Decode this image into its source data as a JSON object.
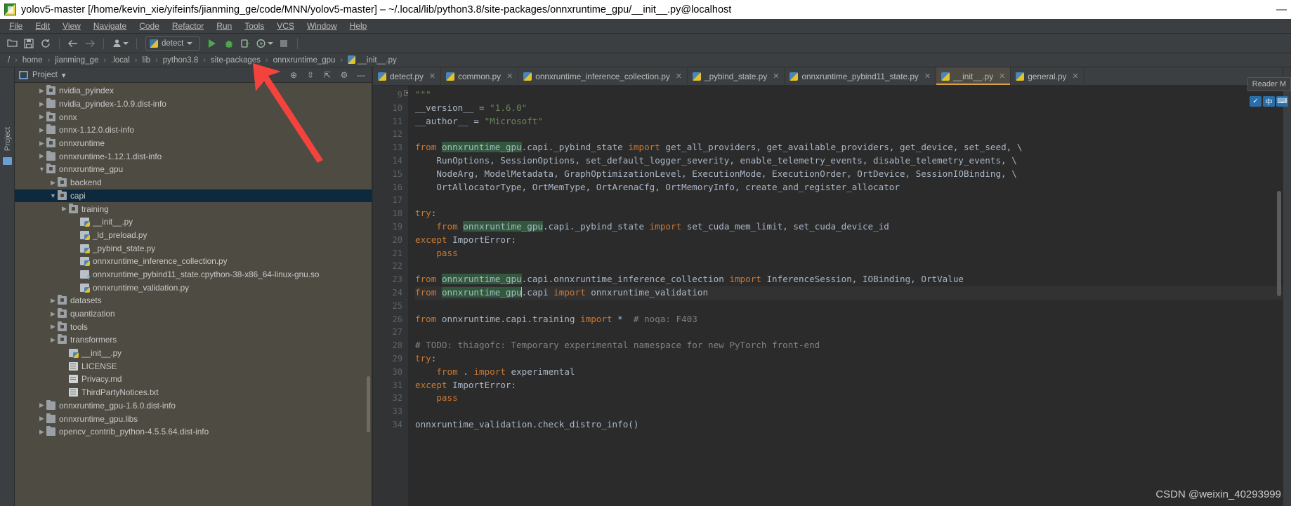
{
  "window": {
    "title": "yolov5-master [/home/kevin_xie/yifeinfs/jianming_ge/code/MNN/yolov5-master] – ~/.local/lib/python3.8/site-packages/onnxruntime_gpu/__init__.py@localhost",
    "icon": "pycharm-icon",
    "minimize": "—",
    "maximize": "▢",
    "close": "✕"
  },
  "menubar": {
    "items": [
      {
        "label": "File"
      },
      {
        "label": "Edit"
      },
      {
        "label": "View"
      },
      {
        "label": "Navigate"
      },
      {
        "label": "Code"
      },
      {
        "label": "Refactor"
      },
      {
        "label": "Run"
      },
      {
        "label": "Tools"
      },
      {
        "label": "VCS"
      },
      {
        "label": "Window"
      },
      {
        "label": "Help"
      }
    ]
  },
  "toolbar": {
    "open_label": "📂",
    "save_label": "🖫",
    "sync_label": "⟳",
    "back_label": "←",
    "forward_label": "→",
    "profile_label": "👤",
    "run_config": "detect",
    "run_label": "▶",
    "debug_label": "🐞",
    "coverage_label": "▣",
    "profile_run_label": "◷",
    "stop_label": "■"
  },
  "breadcrumb": {
    "separator": "›",
    "items": [
      {
        "label": "/"
      },
      {
        "label": "home"
      },
      {
        "label": "jianming_ge"
      },
      {
        "label": ".local"
      },
      {
        "label": "lib"
      },
      {
        "label": "python3.8"
      },
      {
        "label": "site-packages"
      },
      {
        "label": "onnxruntime_gpu"
      },
      {
        "label": "__init__.py",
        "icon": "python-file-icon"
      }
    ]
  },
  "left_rail": {
    "project_label": "Project",
    "structure_icon": "structure-icon"
  },
  "project_panel": {
    "title": "Project",
    "dropdown": "▾",
    "buttons": [
      {
        "name": "locate-button",
        "glyph": "⊕"
      },
      {
        "name": "expand-all-button",
        "glyph": "⇳"
      },
      {
        "name": "collapse-all-button",
        "glyph": "⇱"
      },
      {
        "name": "settings-button",
        "glyph": "⚙"
      },
      {
        "name": "hide-button",
        "glyph": "—"
      }
    ],
    "tree": [
      {
        "label": "nvidia_pyindex",
        "indent": 2,
        "arrow": "collapsed",
        "icon": "package-icon"
      },
      {
        "label": "nvidia_pyindex-1.0.9.dist-info",
        "indent": 2,
        "arrow": "collapsed",
        "icon": "folder-icon"
      },
      {
        "label": "onnx",
        "indent": 2,
        "arrow": "collapsed",
        "icon": "package-icon"
      },
      {
        "label": "onnx-1.12.0.dist-info",
        "indent": 2,
        "arrow": "collapsed",
        "icon": "folder-icon"
      },
      {
        "label": "onnxruntime",
        "indent": 2,
        "arrow": "collapsed",
        "icon": "package-icon"
      },
      {
        "label": "onnxruntime-1.12.1.dist-info",
        "indent": 2,
        "arrow": "collapsed",
        "icon": "folder-icon"
      },
      {
        "label": "onnxruntime_gpu",
        "indent": 2,
        "arrow": "expanded",
        "icon": "package-icon"
      },
      {
        "label": "backend",
        "indent": 3,
        "arrow": "collapsed",
        "icon": "package-icon"
      },
      {
        "label": "capi",
        "indent": 3,
        "arrow": "expanded",
        "icon": "package-icon",
        "selected": true
      },
      {
        "label": "training",
        "indent": 4,
        "arrow": "collapsed",
        "icon": "package-icon"
      },
      {
        "label": "__init__.py",
        "indent": 5,
        "arrow": "none",
        "icon": "python-file-icon"
      },
      {
        "label": "_ld_preload.py",
        "indent": 5,
        "arrow": "none",
        "icon": "python-file-icon"
      },
      {
        "label": "_pybind_state.py",
        "indent": 5,
        "arrow": "none",
        "icon": "python-file-icon"
      },
      {
        "label": "onnxruntime_inference_collection.py",
        "indent": 5,
        "arrow": "none",
        "icon": "python-file-icon"
      },
      {
        "label": "onnxruntime_pybind11_state.cpython-38-x86_64-linux-gnu.so",
        "indent": 5,
        "arrow": "none",
        "icon": "binary-file-icon"
      },
      {
        "label": "onnxruntime_validation.py",
        "indent": 5,
        "arrow": "none",
        "icon": "python-file-icon"
      },
      {
        "label": "datasets",
        "indent": 3,
        "arrow": "collapsed",
        "icon": "package-icon"
      },
      {
        "label": "quantization",
        "indent": 3,
        "arrow": "collapsed",
        "icon": "package-icon"
      },
      {
        "label": "tools",
        "indent": 3,
        "arrow": "collapsed",
        "icon": "package-icon"
      },
      {
        "label": "transformers",
        "indent": 3,
        "arrow": "collapsed",
        "icon": "package-icon"
      },
      {
        "label": "__init__.py",
        "indent": 4,
        "arrow": "none",
        "icon": "python-file-icon"
      },
      {
        "label": "LICENSE",
        "indent": 4,
        "arrow": "none",
        "icon": "text-file-icon"
      },
      {
        "label": "Privacy.md",
        "indent": 4,
        "arrow": "none",
        "icon": "markdown-file-icon"
      },
      {
        "label": "ThirdPartyNotices.txt",
        "indent": 4,
        "arrow": "none",
        "icon": "text-file-icon"
      },
      {
        "label": "onnxruntime_gpu-1.6.0.dist-info",
        "indent": 2,
        "arrow": "collapsed",
        "icon": "folder-icon"
      },
      {
        "label": "onnxruntime_gpu.libs",
        "indent": 2,
        "arrow": "collapsed",
        "icon": "folder-icon"
      },
      {
        "label": "opencv_contrib_python-4.5.5.64.dist-info",
        "indent": 2,
        "arrow": "collapsed",
        "icon": "folder-icon"
      }
    ]
  },
  "editor": {
    "tabs": [
      {
        "label": "detect.py",
        "active": false,
        "close": "✕"
      },
      {
        "label": "common.py",
        "active": false,
        "close": "✕"
      },
      {
        "label": "onnxruntime_inference_collection.py",
        "active": false,
        "close": "✕"
      },
      {
        "label": "_pybind_state.py",
        "active": false,
        "close": "✕"
      },
      {
        "label": "onnxruntime_pybind11_state.py",
        "active": false,
        "close": "✕"
      },
      {
        "label": "__init__.py",
        "active": true,
        "close": "✕"
      },
      {
        "label": "general.py",
        "active": false,
        "close": "✕"
      }
    ],
    "first_line_number": 9,
    "line_numbers": [
      9,
      10,
      11,
      12,
      13,
      14,
      15,
      16,
      17,
      18,
      19,
      20,
      21,
      22,
      23,
      24,
      25,
      26,
      27,
      28,
      29,
      30,
      31,
      32,
      33,
      34
    ],
    "current_line": 24,
    "lines": [
      "\"\"\"",
      "__version__ = \"1.6.0\"",
      "__author__ = \"Microsoft\"",
      "",
      "from onnxruntime_gpu.capi._pybind_state import get_all_providers, get_available_providers, get_device, set_seed, \\",
      "    RunOptions, SessionOptions, set_default_logger_severity, enable_telemetry_events, disable_telemetry_events, \\",
      "    NodeArg, ModelMetadata, GraphOptimizationLevel, ExecutionMode, ExecutionOrder, OrtDevice, SessionIOBinding, \\",
      "    OrtAllocatorType, OrtMemType, OrtArenaCfg, OrtMemoryInfo, create_and_register_allocator",
      "",
      "try:",
      "    from onnxruntime_gpu.capi._pybind_state import set_cuda_mem_limit, set_cuda_device_id",
      "except ImportError:",
      "    pass",
      "",
      "from onnxruntime_gpu.capi.onnxruntime_inference_collection import InferenceSession, IOBinding, OrtValue",
      "from onnxruntime_gpu.capi import onnxruntime_validation",
      "",
      "from onnxruntime.capi.training import *  # noqa: F403",
      "",
      "# TODO: thiagofc: Temporary experimental namespace for new PyTorch front-end",
      "try:",
      "    from . import experimental",
      "except ImportError:",
      "    pass",
      "",
      "onnxruntime_validation.check_distro_info()"
    ],
    "highlight_token": "onnxruntime_gpu"
  },
  "right_panel": {
    "reader_label": "Reader M",
    "ime_items": [
      "✓",
      "中",
      "⌨"
    ]
  },
  "annotation": {
    "arrow_color": "#f4433c",
    "target": "breadcrumb-onnxruntime-gpu"
  },
  "watermark": {
    "text": "CSDN @weixin_40293999"
  },
  "colors": {
    "keyword": "#cc7832",
    "string": "#6a8759",
    "comment": "#808080",
    "text": "#a9b7c6",
    "highlight": "#32593d",
    "editor_bg": "#2b2b2b",
    "panel_bg": "#4e4b42",
    "chrome_bg": "#3c3f41",
    "selection": "#0d293e",
    "tab_accent": "#d9a343"
  }
}
